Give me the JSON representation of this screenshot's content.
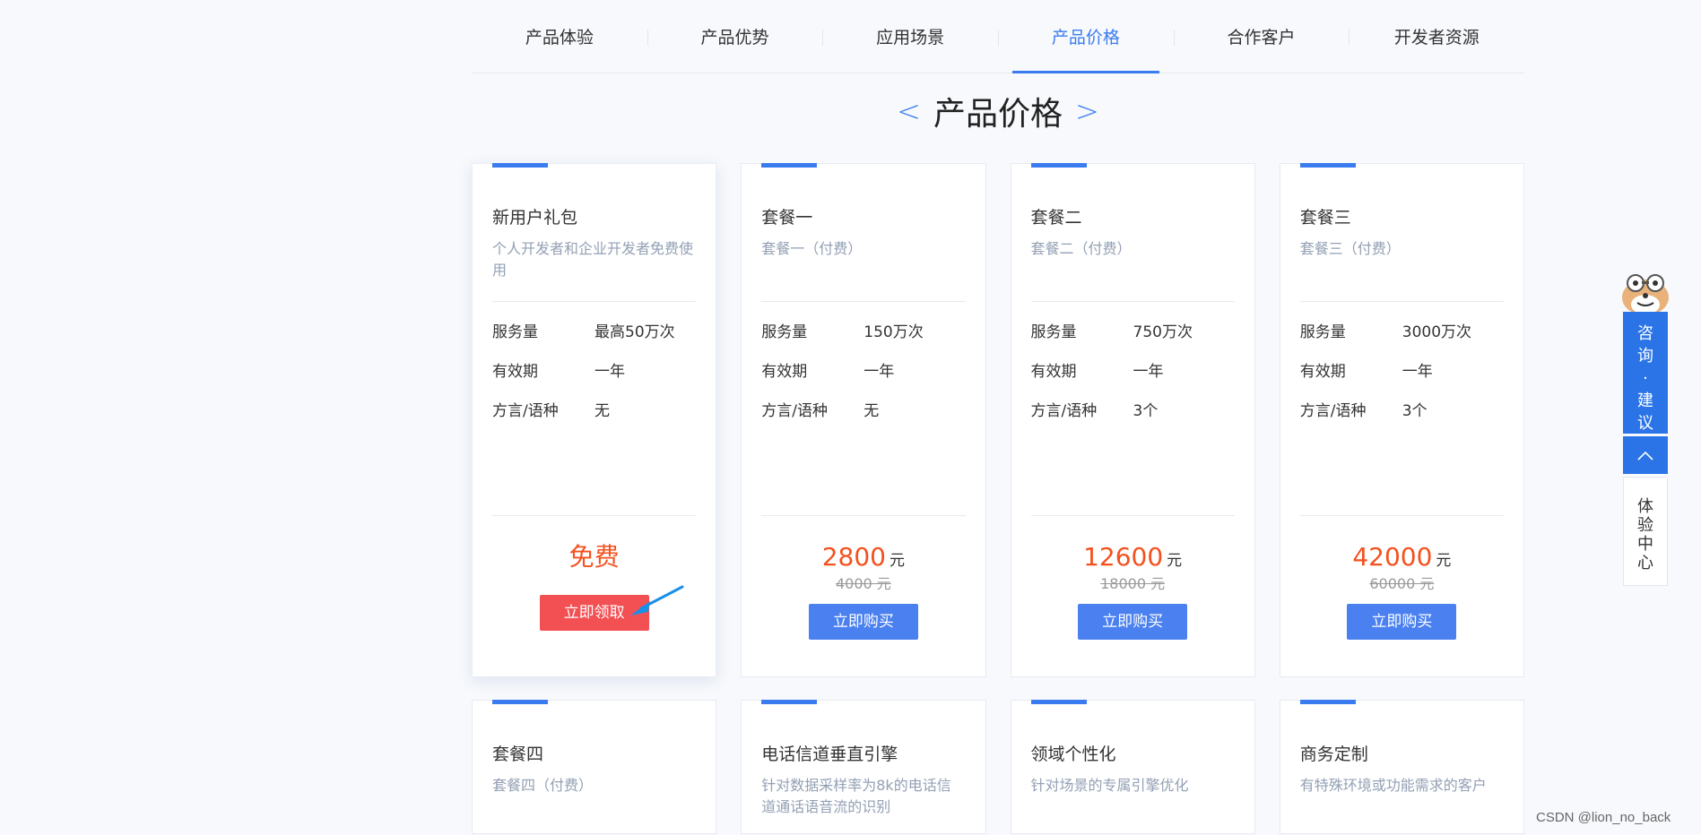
{
  "nav": {
    "items": [
      {
        "label": "产品体验",
        "active": false
      },
      {
        "label": "产品优势",
        "active": false
      },
      {
        "label": "应用场景",
        "active": false
      },
      {
        "label": "产品价格",
        "active": true
      },
      {
        "label": "合作客户",
        "active": false
      },
      {
        "label": "开发者资源",
        "active": false
      }
    ]
  },
  "section": {
    "title": "产品价格",
    "prev_arrow": "<",
    "next_arrow": ">"
  },
  "plans": [
    {
      "title": "新用户礼包",
      "desc": "个人开发者和企业开发者免费使用",
      "specs": [
        {
          "k": "服务量",
          "v": "最高50万次"
        },
        {
          "k": "有效期",
          "v": "一年"
        },
        {
          "k": "方言/语种",
          "v": "无"
        }
      ],
      "free_label": "免费",
      "button": "立即领取"
    },
    {
      "title": "套餐一",
      "desc": "套餐一（付费）",
      "specs": [
        {
          "k": "服务量",
          "v": "150万次"
        },
        {
          "k": "有效期",
          "v": "一年"
        },
        {
          "k": "方言/语种",
          "v": "无"
        }
      ],
      "price": "2800",
      "unit": "元",
      "orig_price": "4000 元",
      "button": "立即购买"
    },
    {
      "title": "套餐二",
      "desc": "套餐二（付费）",
      "specs": [
        {
          "k": "服务量",
          "v": "750万次"
        },
        {
          "k": "有效期",
          "v": "一年"
        },
        {
          "k": "方言/语种",
          "v": "3个"
        }
      ],
      "price": "12600",
      "unit": "元",
      "orig_price": "18000 元",
      "button": "立即购买"
    },
    {
      "title": "套餐三",
      "desc": "套餐三（付费）",
      "specs": [
        {
          "k": "服务量",
          "v": "3000万次"
        },
        {
          "k": "有效期",
          "v": "一年"
        },
        {
          "k": "方言/语种",
          "v": "3个"
        }
      ],
      "price": "42000",
      "unit": "元",
      "orig_price": "60000 元",
      "button": "立即购买"
    }
  ],
  "plans_row2": [
    {
      "title": "套餐四",
      "desc": "套餐四（付费）"
    },
    {
      "title": "电话信道垂直引擎",
      "desc": "针对数据采样率为8k的电话信道通话语音流的识别"
    },
    {
      "title": "领域个性化",
      "desc": "针对场景的专属引擎优化"
    },
    {
      "title": "商务定制",
      "desc": "有特殊环境或功能需求的客户"
    }
  ],
  "float_panel": {
    "consult_lines": [
      "咨",
      "询",
      "·",
      "建",
      "议"
    ],
    "experience_lines": [
      "体",
      "验",
      "中",
      "心"
    ],
    "up_icon": "chevron-up-icon",
    "mascot_icon": "mascot-icon"
  },
  "colors": {
    "accent": "#3a7cf0",
    "price": "#f4511e",
    "free_button": "#f35054",
    "panel_blue": "#2a74e8"
  },
  "watermark": "CSDN @lion_no_back"
}
